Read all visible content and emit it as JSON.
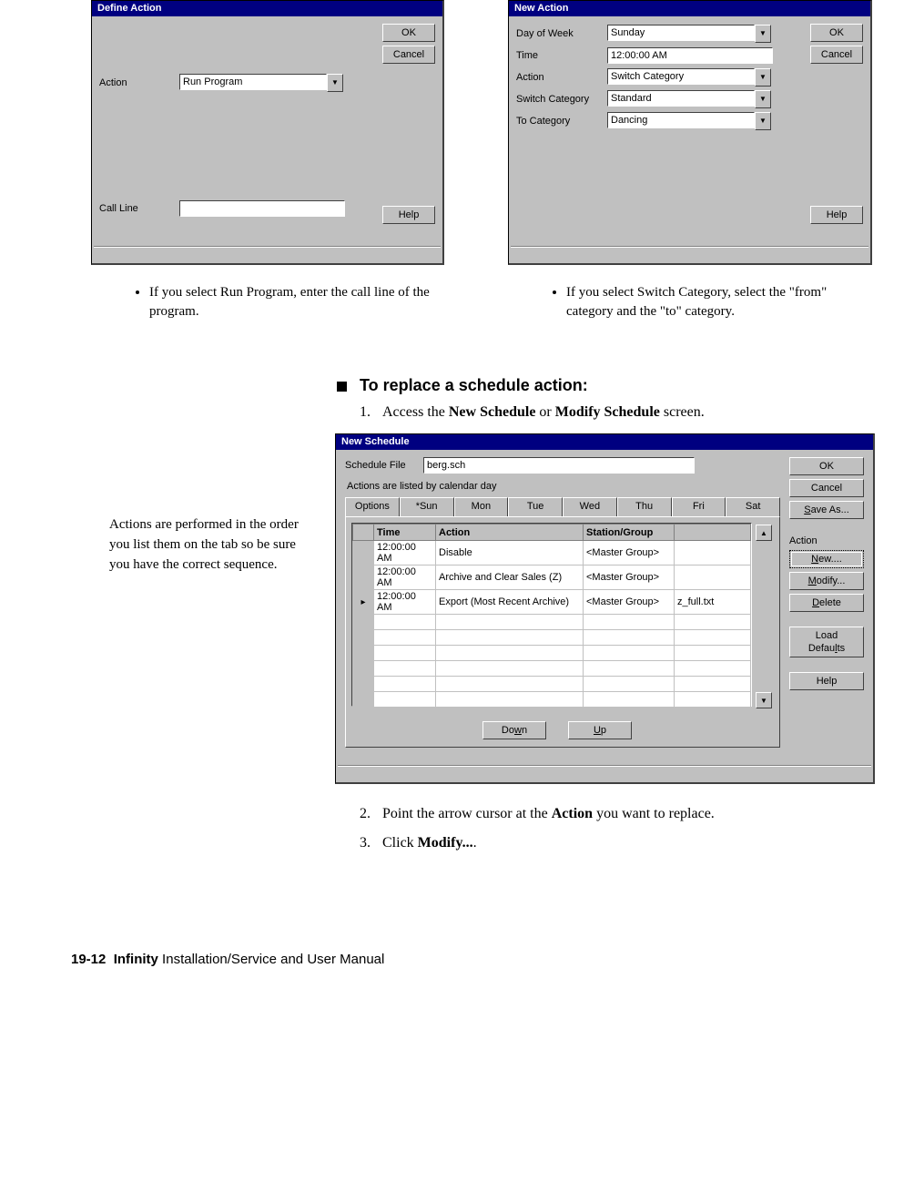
{
  "defineAction": {
    "title": "Define Action",
    "ok": "OK",
    "cancel": "Cancel",
    "actionLabel": "Action",
    "actionValue": "Run Program",
    "callLineLabel": "Call Line",
    "callLineValue": "",
    "help": "Help"
  },
  "newAction": {
    "title": "New Action",
    "ok": "OK",
    "cancel": "Cancel",
    "help": "Help",
    "fields": {
      "dayLabel": "Day of Week",
      "dayValue": "Sunday",
      "timeLabel": "Time",
      "timeValue": "12:00:00 AM",
      "actionLabel": "Action",
      "actionValue": "Switch Category",
      "switchLabel": "Switch Category",
      "switchValue": "Standard",
      "toLabel": "To Category",
      "toValue": "Dancing"
    }
  },
  "bulletLeft": "If you select Run Program, enter the call line of the program.",
  "bulletRight": "If you select Switch Category, select the \"from\" category and the \"to\" category.",
  "sectionHeader": "To replace a schedule action:",
  "steps": {
    "s1_pre": "Access the ",
    "s1_b1": "New Schedule",
    "s1_mid": " or ",
    "s1_b2": "Modify Schedule",
    "s1_post": " screen.",
    "s2_pre": "Point the arrow cursor at the ",
    "s2_b": "Action",
    "s2_post": " you want to replace.",
    "s3_pre": "Click ",
    "s3_b": "Modify...",
    "s3_post": "."
  },
  "sideNote": "Actions are performed in the order you list them on the tab so be sure you have the correct sequence.",
  "schedule": {
    "title": "New Schedule",
    "ok": "OK",
    "cancel": "Cancel",
    "saveAs": "Save As...",
    "actionLabel": "Action",
    "new": "New....",
    "modify": "Modify...",
    "delete": "Delete",
    "loadDefaults": "Load Defaults",
    "help": "Help",
    "fileLabel": "Schedule File",
    "fileValue": "berg.sch",
    "note": "Actions are listed by calendar day",
    "tabs": [
      "Options",
      "*Sun",
      "Mon",
      "Tue",
      "Wed",
      "Thu",
      "Fri",
      "Sat"
    ],
    "headers": {
      "time": "Time",
      "action": "Action",
      "station": "Station/Group"
    },
    "rows": [
      {
        "marker": "",
        "time": "12:00:00 AM",
        "action": "Disable",
        "station": "<Master Group>",
        "extra": ""
      },
      {
        "marker": "",
        "time": "12:00:00 AM",
        "action": "Archive and Clear Sales (Z)",
        "station": "<Master Group>",
        "extra": ""
      },
      {
        "marker": "▸",
        "time": "12:00:00 AM",
        "action": "Export (Most Recent Archive)",
        "station": "<Master Group>",
        "extra": "z_full.txt"
      }
    ],
    "down": "Down",
    "up": "Up"
  },
  "footer": {
    "page": "19-12",
    "bold": "Infinity",
    "rest": " Installation/Service and User Manual"
  }
}
